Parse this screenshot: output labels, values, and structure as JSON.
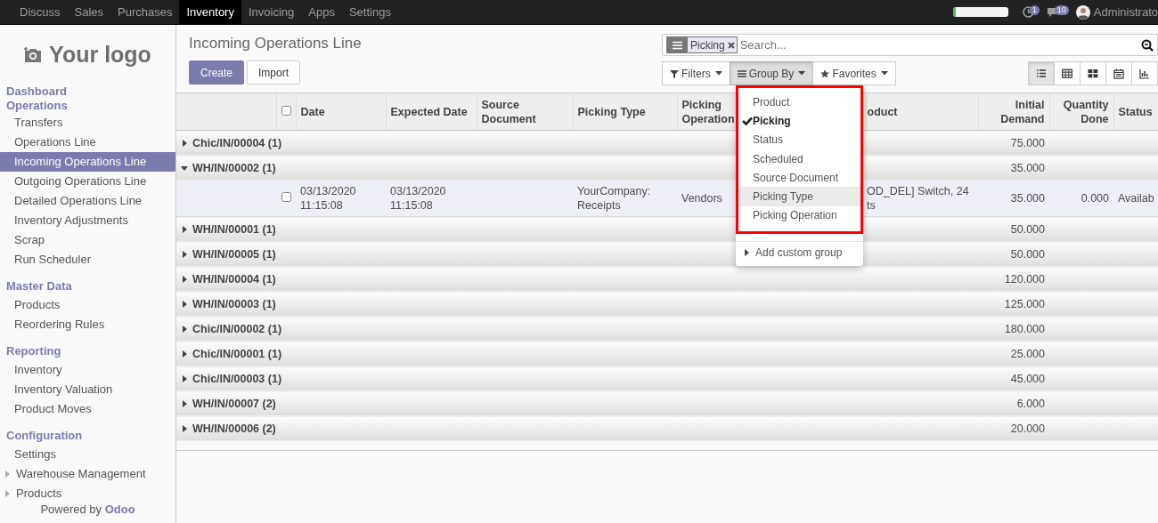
{
  "navbar": {
    "apps": [
      {
        "label": "Discuss",
        "selected": false
      },
      {
        "label": "Sales",
        "selected": false
      },
      {
        "label": "Purchases",
        "selected": false
      },
      {
        "label": "Inventory",
        "selected": true
      },
      {
        "label": "Invoicing",
        "selected": false
      },
      {
        "label": "Apps",
        "selected": false
      },
      {
        "label": "Settings",
        "selected": false
      }
    ],
    "meter": {
      "level": 0.06
    },
    "activity_count": "1",
    "message_count": "10",
    "user": "Administrato"
  },
  "sidebar": {
    "logo": "Your logo",
    "sections": [
      {
        "title": "Dashboard"
      },
      {
        "title": "Operations",
        "items": [
          {
            "label": "Transfers",
            "kind": "link",
            "selected": false
          },
          {
            "label": "Operations Line",
            "kind": "link",
            "selected": false
          },
          {
            "label": "Incoming Operations Line",
            "kind": "link",
            "selected": true
          },
          {
            "label": "Outgoing Operations Line",
            "kind": "link",
            "selected": false
          },
          {
            "label": "Detailed Operations Line",
            "kind": "link",
            "selected": false
          },
          {
            "label": "Inventory Adjustments",
            "kind": "link",
            "selected": false
          },
          {
            "label": "Scrap",
            "kind": "link",
            "selected": false
          },
          {
            "label": "Run Scheduler",
            "kind": "link",
            "selected": false
          }
        ]
      },
      {
        "title": "Master Data",
        "items": [
          {
            "label": "Products",
            "kind": "link",
            "selected": false
          },
          {
            "label": "Reordering Rules",
            "kind": "link",
            "selected": false
          }
        ]
      },
      {
        "title": "Reporting",
        "items": [
          {
            "label": "Inventory",
            "kind": "link",
            "selected": false
          },
          {
            "label": "Inventory Valuation",
            "kind": "link",
            "selected": false
          },
          {
            "label": "Product Moves",
            "kind": "link",
            "selected": false
          }
        ]
      },
      {
        "title": "Configuration",
        "items": [
          {
            "label": "Settings",
            "kind": "link",
            "selected": false
          },
          {
            "label": "Warehouse Management",
            "kind": "folder",
            "expanded": false
          },
          {
            "label": "Products",
            "kind": "folder",
            "expanded": false
          }
        ]
      }
    ],
    "footer": {
      "prefix": "Powered by",
      "brand": "Odoo"
    }
  },
  "control_panel": {
    "title": "Incoming Operations Line",
    "buttons": [
      {
        "label": "Create",
        "kind": "primary"
      },
      {
        "label": "Import",
        "kind": "secondary"
      }
    ],
    "search": {
      "facets": [
        {
          "label": "Picking"
        }
      ],
      "placeholder": "Search..."
    },
    "menus": [
      {
        "label": "Filters",
        "kind": "filter",
        "open": false
      },
      {
        "label": "Group By",
        "kind": "bars",
        "open": true
      },
      {
        "label": "Favorites",
        "kind": "star",
        "open": false
      }
    ],
    "views": [
      {
        "kind": "list",
        "selected": true
      },
      {
        "kind": "grid",
        "selected": false
      },
      {
        "kind": "kanban",
        "selected": false
      },
      {
        "kind": "calendar",
        "selected": false
      },
      {
        "kind": "graph",
        "selected": false
      }
    ]
  },
  "group_by_menu": {
    "options": [
      {
        "label": "Product",
        "checked": false,
        "highlighted": false
      },
      {
        "label": "Picking",
        "checked": true,
        "highlighted": false
      },
      {
        "label": "Status",
        "checked": false,
        "highlighted": false
      },
      {
        "label": "Scheduled",
        "checked": false,
        "highlighted": false
      },
      {
        "label": "Source Document",
        "checked": false,
        "highlighted": false
      },
      {
        "label": "Picking Type",
        "checked": false,
        "highlighted": true
      },
      {
        "label": "Picking Operation",
        "checked": false,
        "highlighted": false
      }
    ],
    "custom": "Add custom group"
  },
  "table": {
    "select_all": {
      "checked": false
    },
    "columns": [
      {
        "label": "Date",
        "kind": "text"
      },
      {
        "label": "Expected Date",
        "kind": "text"
      },
      {
        "label": "Source Document",
        "kind": "text"
      },
      {
        "label": "Picking Type",
        "kind": "text"
      },
      {
        "label": "Picking Operation",
        "kind": "text"
      },
      {
        "label": "oduct",
        "kind": "text"
      },
      {
        "label": "Initial Demand",
        "kind": "number"
      },
      {
        "label": "Quantity Done",
        "kind": "number"
      },
      {
        "label": "Status",
        "kind": "text"
      }
    ],
    "rows": [
      {
        "kind": "group",
        "label": "Chic/IN/00004 (1)",
        "expanded": false,
        "total": "75.000"
      },
      {
        "kind": "group",
        "label": "WH/IN/00002 (1)",
        "expanded": true,
        "total": "35.000"
      },
      {
        "kind": "record",
        "checked": false,
        "cells": [
          "03/13/2020\n11:15:08",
          "03/13/2020\n11:15:08",
          null,
          "YourCompany:\nReceipts",
          "Vendors",
          "OD_DEL] Switch, 24\nts",
          "35.000",
          "0.000",
          "Availab"
        ]
      },
      {
        "kind": "group",
        "label": "WH/IN/00001 (1)",
        "expanded": false,
        "total": "50.000"
      },
      {
        "kind": "group",
        "label": "WH/IN/00005 (1)",
        "expanded": false,
        "total": "50.000"
      },
      {
        "kind": "group",
        "label": "WH/IN/00004 (1)",
        "expanded": false,
        "total": "120.000"
      },
      {
        "kind": "group",
        "label": "WH/IN/00003 (1)",
        "expanded": false,
        "total": "125.000"
      },
      {
        "kind": "group",
        "label": "Chic/IN/00002 (1)",
        "expanded": false,
        "total": "180.000"
      },
      {
        "kind": "group",
        "label": "Chic/IN/00001 (1)",
        "expanded": false,
        "total": "25.000"
      },
      {
        "kind": "group",
        "label": "Chic/IN/00003 (1)",
        "expanded": false,
        "total": "45.000"
      },
      {
        "kind": "group",
        "label": "WH/IN/00007 (2)",
        "expanded": false,
        "total": "6.000"
      },
      {
        "kind": "group",
        "label": "WH/IN/00006 (2)",
        "expanded": false,
        "total": "20.000"
      }
    ]
  }
}
